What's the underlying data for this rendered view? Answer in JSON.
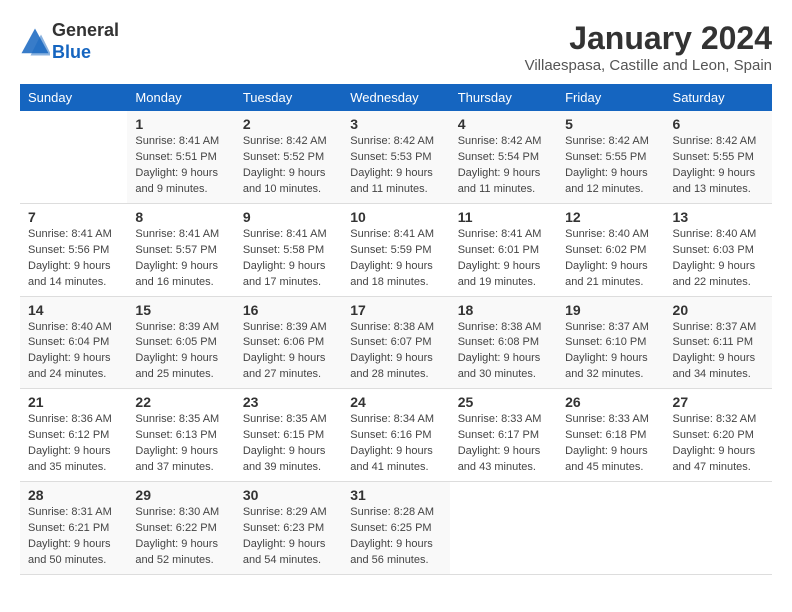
{
  "logo": {
    "line1": "General",
    "line2": "Blue"
  },
  "title": "January 2024",
  "subtitle": "Villaespasa, Castille and Leon, Spain",
  "days_header": [
    "Sunday",
    "Monday",
    "Tuesday",
    "Wednesday",
    "Thursday",
    "Friday",
    "Saturday"
  ],
  "weeks": [
    [
      {
        "day": "",
        "info": ""
      },
      {
        "day": "1",
        "info": "Sunrise: 8:41 AM\nSunset: 5:51 PM\nDaylight: 9 hours\nand 9 minutes."
      },
      {
        "day": "2",
        "info": "Sunrise: 8:42 AM\nSunset: 5:52 PM\nDaylight: 9 hours\nand 10 minutes."
      },
      {
        "day": "3",
        "info": "Sunrise: 8:42 AM\nSunset: 5:53 PM\nDaylight: 9 hours\nand 11 minutes."
      },
      {
        "day": "4",
        "info": "Sunrise: 8:42 AM\nSunset: 5:54 PM\nDaylight: 9 hours\nand 11 minutes."
      },
      {
        "day": "5",
        "info": "Sunrise: 8:42 AM\nSunset: 5:55 PM\nDaylight: 9 hours\nand 12 minutes."
      },
      {
        "day": "6",
        "info": "Sunrise: 8:42 AM\nSunset: 5:55 PM\nDaylight: 9 hours\nand 13 minutes."
      }
    ],
    [
      {
        "day": "7",
        "info": "Sunrise: 8:41 AM\nSunset: 5:56 PM\nDaylight: 9 hours\nand 14 minutes."
      },
      {
        "day": "8",
        "info": "Sunrise: 8:41 AM\nSunset: 5:57 PM\nDaylight: 9 hours\nand 16 minutes."
      },
      {
        "day": "9",
        "info": "Sunrise: 8:41 AM\nSunset: 5:58 PM\nDaylight: 9 hours\nand 17 minutes."
      },
      {
        "day": "10",
        "info": "Sunrise: 8:41 AM\nSunset: 5:59 PM\nDaylight: 9 hours\nand 18 minutes."
      },
      {
        "day": "11",
        "info": "Sunrise: 8:41 AM\nSunset: 6:01 PM\nDaylight: 9 hours\nand 19 minutes."
      },
      {
        "day": "12",
        "info": "Sunrise: 8:40 AM\nSunset: 6:02 PM\nDaylight: 9 hours\nand 21 minutes."
      },
      {
        "day": "13",
        "info": "Sunrise: 8:40 AM\nSunset: 6:03 PM\nDaylight: 9 hours\nand 22 minutes."
      }
    ],
    [
      {
        "day": "14",
        "info": "Sunrise: 8:40 AM\nSunset: 6:04 PM\nDaylight: 9 hours\nand 24 minutes."
      },
      {
        "day": "15",
        "info": "Sunrise: 8:39 AM\nSunset: 6:05 PM\nDaylight: 9 hours\nand 25 minutes."
      },
      {
        "day": "16",
        "info": "Sunrise: 8:39 AM\nSunset: 6:06 PM\nDaylight: 9 hours\nand 27 minutes."
      },
      {
        "day": "17",
        "info": "Sunrise: 8:38 AM\nSunset: 6:07 PM\nDaylight: 9 hours\nand 28 minutes."
      },
      {
        "day": "18",
        "info": "Sunrise: 8:38 AM\nSunset: 6:08 PM\nDaylight: 9 hours\nand 30 minutes."
      },
      {
        "day": "19",
        "info": "Sunrise: 8:37 AM\nSunset: 6:10 PM\nDaylight: 9 hours\nand 32 minutes."
      },
      {
        "day": "20",
        "info": "Sunrise: 8:37 AM\nSunset: 6:11 PM\nDaylight: 9 hours\nand 34 minutes."
      }
    ],
    [
      {
        "day": "21",
        "info": "Sunrise: 8:36 AM\nSunset: 6:12 PM\nDaylight: 9 hours\nand 35 minutes."
      },
      {
        "day": "22",
        "info": "Sunrise: 8:35 AM\nSunset: 6:13 PM\nDaylight: 9 hours\nand 37 minutes."
      },
      {
        "day": "23",
        "info": "Sunrise: 8:35 AM\nSunset: 6:15 PM\nDaylight: 9 hours\nand 39 minutes."
      },
      {
        "day": "24",
        "info": "Sunrise: 8:34 AM\nSunset: 6:16 PM\nDaylight: 9 hours\nand 41 minutes."
      },
      {
        "day": "25",
        "info": "Sunrise: 8:33 AM\nSunset: 6:17 PM\nDaylight: 9 hours\nand 43 minutes."
      },
      {
        "day": "26",
        "info": "Sunrise: 8:33 AM\nSunset: 6:18 PM\nDaylight: 9 hours\nand 45 minutes."
      },
      {
        "day": "27",
        "info": "Sunrise: 8:32 AM\nSunset: 6:20 PM\nDaylight: 9 hours\nand 47 minutes."
      }
    ],
    [
      {
        "day": "28",
        "info": "Sunrise: 8:31 AM\nSunset: 6:21 PM\nDaylight: 9 hours\nand 50 minutes."
      },
      {
        "day": "29",
        "info": "Sunrise: 8:30 AM\nSunset: 6:22 PM\nDaylight: 9 hours\nand 52 minutes."
      },
      {
        "day": "30",
        "info": "Sunrise: 8:29 AM\nSunset: 6:23 PM\nDaylight: 9 hours\nand 54 minutes."
      },
      {
        "day": "31",
        "info": "Sunrise: 8:28 AM\nSunset: 6:25 PM\nDaylight: 9 hours\nand 56 minutes."
      },
      {
        "day": "",
        "info": ""
      },
      {
        "day": "",
        "info": ""
      },
      {
        "day": "",
        "info": ""
      }
    ]
  ]
}
